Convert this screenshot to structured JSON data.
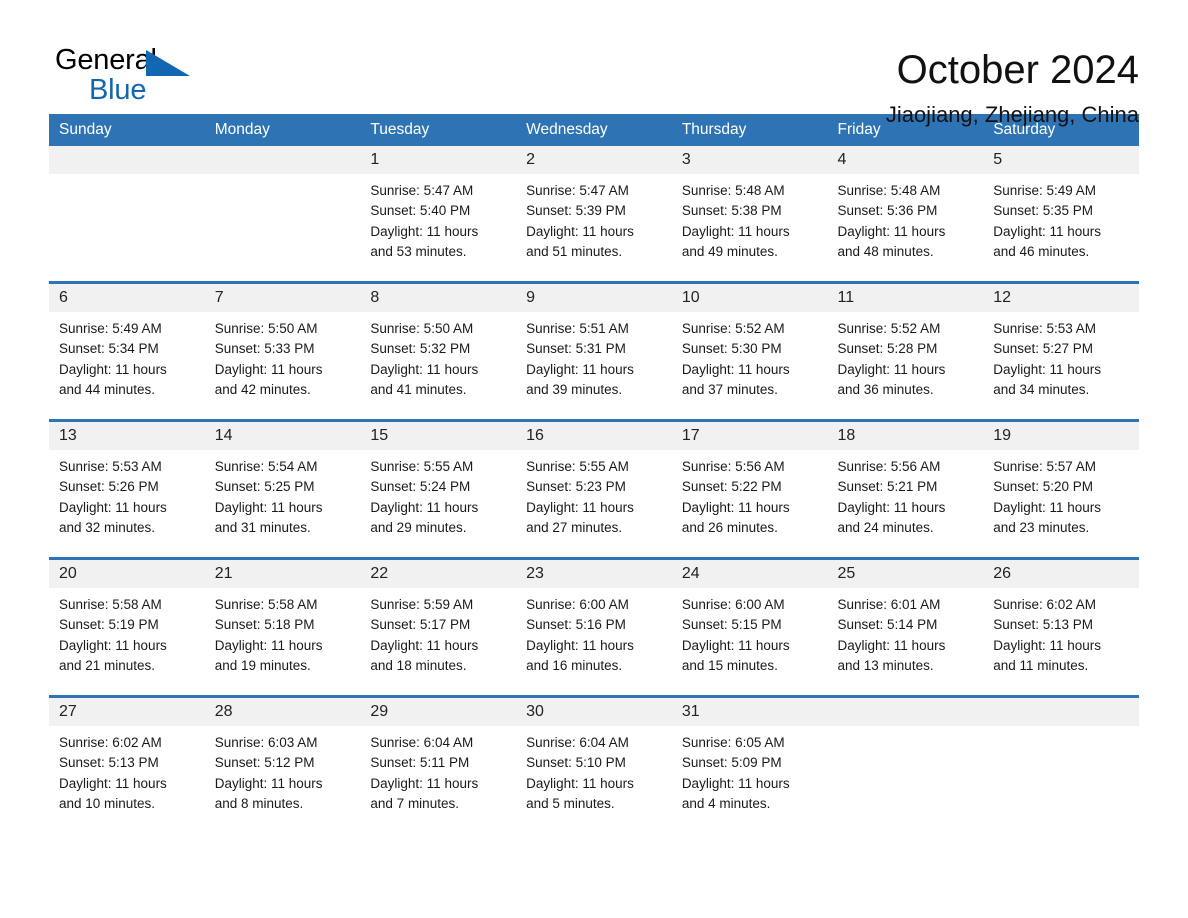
{
  "brand": {
    "name_dark": "General",
    "name_light": "Blue",
    "triangle_color": "#1267b0"
  },
  "header": {
    "title": "October 2024",
    "location": "Jiaojiang, Zhejiang, China"
  },
  "theme": {
    "header_blue": "#2e74b5",
    "row_divider_blue": "#2e74b5",
    "daynum_band": "#f1f1f1",
    "text": "#1a1a1a"
  },
  "calendar": {
    "weekday_headers": [
      "Sunday",
      "Monday",
      "Tuesday",
      "Wednesday",
      "Thursday",
      "Friday",
      "Saturday"
    ],
    "weeks": [
      [
        {
          "day": "",
          "lines": ""
        },
        {
          "day": "",
          "lines": ""
        },
        {
          "day": "1",
          "lines": "Sunrise: 5:47 AM\nSunset: 5:40 PM\nDaylight: 11 hours\nand 53 minutes."
        },
        {
          "day": "2",
          "lines": "Sunrise: 5:47 AM\nSunset: 5:39 PM\nDaylight: 11 hours\nand 51 minutes."
        },
        {
          "day": "3",
          "lines": "Sunrise: 5:48 AM\nSunset: 5:38 PM\nDaylight: 11 hours\nand 49 minutes."
        },
        {
          "day": "4",
          "lines": "Sunrise: 5:48 AM\nSunset: 5:36 PM\nDaylight: 11 hours\nand 48 minutes."
        },
        {
          "day": "5",
          "lines": "Sunrise: 5:49 AM\nSunset: 5:35 PM\nDaylight: 11 hours\nand 46 minutes."
        }
      ],
      [
        {
          "day": "6",
          "lines": "Sunrise: 5:49 AM\nSunset: 5:34 PM\nDaylight: 11 hours\nand 44 minutes."
        },
        {
          "day": "7",
          "lines": "Sunrise: 5:50 AM\nSunset: 5:33 PM\nDaylight: 11 hours\nand 42 minutes."
        },
        {
          "day": "8",
          "lines": "Sunrise: 5:50 AM\nSunset: 5:32 PM\nDaylight: 11 hours\nand 41 minutes."
        },
        {
          "day": "9",
          "lines": "Sunrise: 5:51 AM\nSunset: 5:31 PM\nDaylight: 11 hours\nand 39 minutes."
        },
        {
          "day": "10",
          "lines": "Sunrise: 5:52 AM\nSunset: 5:30 PM\nDaylight: 11 hours\nand 37 minutes."
        },
        {
          "day": "11",
          "lines": "Sunrise: 5:52 AM\nSunset: 5:28 PM\nDaylight: 11 hours\nand 36 minutes."
        },
        {
          "day": "12",
          "lines": "Sunrise: 5:53 AM\nSunset: 5:27 PM\nDaylight: 11 hours\nand 34 minutes."
        }
      ],
      [
        {
          "day": "13",
          "lines": "Sunrise: 5:53 AM\nSunset: 5:26 PM\nDaylight: 11 hours\nand 32 minutes."
        },
        {
          "day": "14",
          "lines": "Sunrise: 5:54 AM\nSunset: 5:25 PM\nDaylight: 11 hours\nand 31 minutes."
        },
        {
          "day": "15",
          "lines": "Sunrise: 5:55 AM\nSunset: 5:24 PM\nDaylight: 11 hours\nand 29 minutes."
        },
        {
          "day": "16",
          "lines": "Sunrise: 5:55 AM\nSunset: 5:23 PM\nDaylight: 11 hours\nand 27 minutes."
        },
        {
          "day": "17",
          "lines": "Sunrise: 5:56 AM\nSunset: 5:22 PM\nDaylight: 11 hours\nand 26 minutes."
        },
        {
          "day": "18",
          "lines": "Sunrise: 5:56 AM\nSunset: 5:21 PM\nDaylight: 11 hours\nand 24 minutes."
        },
        {
          "day": "19",
          "lines": "Sunrise: 5:57 AM\nSunset: 5:20 PM\nDaylight: 11 hours\nand 23 minutes."
        }
      ],
      [
        {
          "day": "20",
          "lines": "Sunrise: 5:58 AM\nSunset: 5:19 PM\nDaylight: 11 hours\nand 21 minutes."
        },
        {
          "day": "21",
          "lines": "Sunrise: 5:58 AM\nSunset: 5:18 PM\nDaylight: 11 hours\nand 19 minutes."
        },
        {
          "day": "22",
          "lines": "Sunrise: 5:59 AM\nSunset: 5:17 PM\nDaylight: 11 hours\nand 18 minutes."
        },
        {
          "day": "23",
          "lines": "Sunrise: 6:00 AM\nSunset: 5:16 PM\nDaylight: 11 hours\nand 16 minutes."
        },
        {
          "day": "24",
          "lines": "Sunrise: 6:00 AM\nSunset: 5:15 PM\nDaylight: 11 hours\nand 15 minutes."
        },
        {
          "day": "25",
          "lines": "Sunrise: 6:01 AM\nSunset: 5:14 PM\nDaylight: 11 hours\nand 13 minutes."
        },
        {
          "day": "26",
          "lines": "Sunrise: 6:02 AM\nSunset: 5:13 PM\nDaylight: 11 hours\nand 11 minutes."
        }
      ],
      [
        {
          "day": "27",
          "lines": "Sunrise: 6:02 AM\nSunset: 5:13 PM\nDaylight: 11 hours\nand 10 minutes."
        },
        {
          "day": "28",
          "lines": "Sunrise: 6:03 AM\nSunset: 5:12 PM\nDaylight: 11 hours\nand 8 minutes."
        },
        {
          "day": "29",
          "lines": "Sunrise: 6:04 AM\nSunset: 5:11 PM\nDaylight: 11 hours\nand 7 minutes."
        },
        {
          "day": "30",
          "lines": "Sunrise: 6:04 AM\nSunset: 5:10 PM\nDaylight: 11 hours\nand 5 minutes."
        },
        {
          "day": "31",
          "lines": "Sunrise: 6:05 AM\nSunset: 5:09 PM\nDaylight: 11 hours\nand 4 minutes."
        },
        {
          "day": "",
          "lines": ""
        },
        {
          "day": "",
          "lines": ""
        }
      ]
    ]
  }
}
